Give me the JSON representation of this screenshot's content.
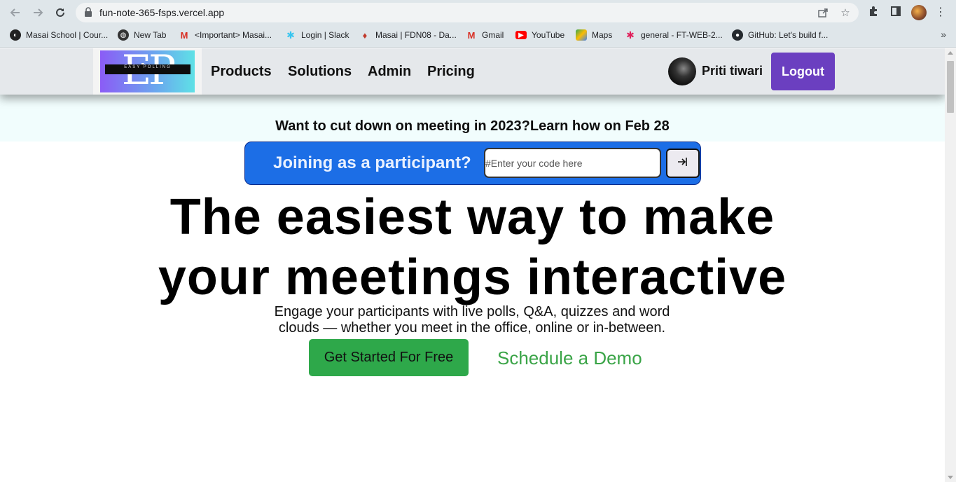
{
  "browser": {
    "url": "fun-note-365-fsps.vercel.app",
    "bookmarks": [
      {
        "label": "Masai School | Cour...",
        "icon": "masai-icon"
      },
      {
        "label": "New Tab",
        "icon": "globe-icon"
      },
      {
        "label": "<Important> Masai...",
        "icon": "gmail-icon"
      },
      {
        "label": "Login | Slack",
        "icon": "slack-icon"
      },
      {
        "label": "Masai | FDN08 - Da...",
        "icon": "masai-pin-icon"
      },
      {
        "label": "Gmail",
        "icon": "gmail-icon"
      },
      {
        "label": "YouTube",
        "icon": "youtube-icon"
      },
      {
        "label": "Maps",
        "icon": "maps-icon"
      },
      {
        "label": "general - FT-WEB-2...",
        "icon": "slack-icon"
      },
      {
        "label": "GitHub: Let's build f...",
        "icon": "github-icon"
      }
    ],
    "more": "»"
  },
  "navbar": {
    "logo_text": "EP",
    "logo_tag": "EASY POLLING",
    "links": [
      "Products",
      "Solutions",
      "Admin",
      "Pricing"
    ],
    "user_name": "Priti tiwari",
    "logout_label": "Logout"
  },
  "banner": {
    "text": "Want to cut down on meeting in 2023?Learn how on Feb 28"
  },
  "join": {
    "label": "Joining as a participant?",
    "placeholder": "#Enter your code here"
  },
  "hero": {
    "title_line1": "The easiest way to make",
    "title_line2": "your meetings interactive",
    "subtitle_line1": "Engage your participants with live polls, Q&A, quizzes and word",
    "subtitle_line2": "clouds — whether you meet in the office, online or in-between.",
    "cta_label": "Get Started For Free",
    "demo_label": "Schedule a Demo"
  },
  "colors": {
    "accent_purple": "#6b3fc0",
    "join_blue": "#1c6ee6",
    "cta_green": "#2ea84a",
    "demo_green": "#3aa447"
  }
}
